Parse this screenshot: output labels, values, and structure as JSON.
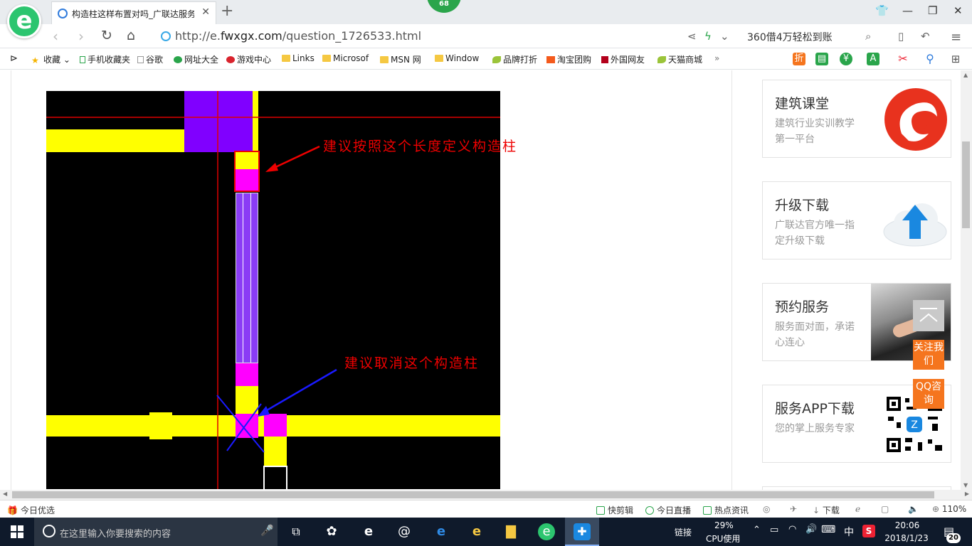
{
  "browser": {
    "badge": "68",
    "tab": {
      "title": "构造柱这样布置对吗_广联达服务"
    },
    "url_prefix": "http://e.",
    "url_domain": "fwxgx.com",
    "url_path": "/question_1726533.html",
    "search_text": "360借4万轻松到账"
  },
  "bookmarks": [
    {
      "label": "收藏",
      "icon": "star-icon"
    },
    {
      "label": "手机收藏夹",
      "icon": "phone-icon"
    },
    {
      "label": "谷歌",
      "icon": "page-icon"
    },
    {
      "label": "网址大全",
      "icon": "globe-icon"
    },
    {
      "label": "游戏中心",
      "icon": "game-icon"
    },
    {
      "label": "Links",
      "icon": "folder-icon"
    },
    {
      "label": "Microsof",
      "icon": "folder-icon"
    },
    {
      "label": "MSN 网",
      "icon": "folder-icon"
    },
    {
      "label": "Window",
      "icon": "folder-icon"
    },
    {
      "label": "品牌打折",
      "icon": "leaf-icon"
    },
    {
      "label": "淘宝团购",
      "icon": "taobao-icon"
    },
    {
      "label": "外国网友",
      "icon": "flag-icon"
    },
    {
      "label": "天猫商城",
      "icon": "leaf-icon"
    }
  ],
  "bookmark_toolbar_icons": {
    "discount": "折"
  },
  "drawing": {
    "note_top": "建议按照这个长度定义构造柱",
    "note_bottom": "建议取消这个构造柱"
  },
  "sidebar": {
    "cards": [
      {
        "title": "建筑课堂",
        "subtitle": "建筑行业实训教学第一平台",
        "icon": "logo-swirl-icon"
      },
      {
        "title": "升级下载",
        "subtitle": "广联达官方唯一指定升级下载",
        "icon": "cloud-upload-icon"
      },
      {
        "title": "预约服务",
        "subtitle": "服务面对面，承诺心连心",
        "icon": "handshake-photo"
      },
      {
        "title": "服务APP下载",
        "subtitle": "您的掌上服务专家",
        "icon": "qr-code-icon"
      }
    ],
    "float_follow": "关注我们",
    "float_qq": "QQ咨询"
  },
  "statusbar": {
    "left": "今日优选",
    "items": [
      "快剪辑",
      "今日直播",
      "热点资讯"
    ],
    "download": "下载",
    "zoom": "110%"
  },
  "taskbar": {
    "search_placeholder": "在这里输入你要搜索的内容",
    "link": "链接",
    "cpu_percent": "29%",
    "cpu_label": "CPU使用",
    "ime": "中",
    "time": "20:06",
    "date": "2018/1/23",
    "notifications": "20"
  },
  "colors": {
    "accent_green": "#2cc56f",
    "annotation_red": "#e00000",
    "column_magenta": "#ff00ff",
    "wall_yellow": "#ffff00",
    "slab_purple": "#8000ff"
  }
}
